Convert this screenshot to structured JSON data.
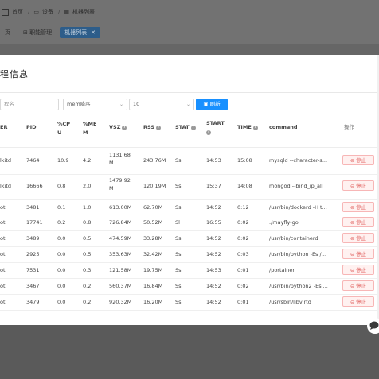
{
  "breadcrumb": {
    "items": [
      "首页",
      "设备",
      "机器列表"
    ]
  },
  "background_tabs": [
    {
      "label": "页"
    },
    {
      "label": "职能管理"
    },
    {
      "label": "机器列表"
    }
  ],
  "modal": {
    "title": "程信息",
    "filters": {
      "search_placeholder": "程名",
      "sort_select": "mem降序",
      "limit_select": "10",
      "refresh_label": "刷新"
    },
    "columns": [
      {
        "label": "ER"
      },
      {
        "label": "PID"
      },
      {
        "label": "%CP",
        "label2": "U"
      },
      {
        "label": "%ME",
        "label2": "M"
      },
      {
        "label": "VSZ",
        "help": true
      },
      {
        "label": "RSS",
        "help": true
      },
      {
        "label": "STAT",
        "help": true
      },
      {
        "label": "START",
        "help_below": true
      },
      {
        "label": "TIME",
        "help": true
      },
      {
        "label": "command"
      },
      {
        "label": "操作"
      }
    ],
    "stop_label": "停止",
    "rows": [
      {
        "user": "lkitd",
        "pid": "7464",
        "cpu": "10.9",
        "mem": "4.2",
        "vsz": "1131.68",
        "vsz2": "M",
        "rss": "243.76M",
        "stat": "Ssl",
        "start": "14:53",
        "time": "15:08",
        "command": "mysqld --character-s..."
      },
      {
        "user": "lkitd",
        "pid": "16666",
        "cpu": "0.8",
        "mem": "2.0",
        "vsz": "1479.92",
        "vsz2": "M",
        "rss": "120.19M",
        "stat": "Ssl",
        "start": "15:37",
        "time": "14:08",
        "command": "mongod --bind_ip_all"
      },
      {
        "user": "ot",
        "pid": "3481",
        "cpu": "0.1",
        "mem": "1.0",
        "vsz": "613.00M",
        "vsz2": "",
        "rss": "62.70M",
        "stat": "Ssl",
        "start": "14:52",
        "time": "0:12",
        "command": "/usr/bin/dockerd -H t..."
      },
      {
        "user": "ot",
        "pid": "17741",
        "cpu": "0.2",
        "mem": "0.8",
        "vsz": "726.84M",
        "vsz2": "",
        "rss": "50.52M",
        "stat": "Sl",
        "start": "16:55",
        "time": "0:02",
        "command": "./mayfly-go"
      },
      {
        "user": "ot",
        "pid": "3489",
        "cpu": "0.0",
        "mem": "0.5",
        "vsz": "474.59M",
        "vsz2": "",
        "rss": "33.28M",
        "stat": "Ssl",
        "start": "14:52",
        "time": "0:02",
        "command": "/usr/bin/containerd"
      },
      {
        "user": "ot",
        "pid": "2925",
        "cpu": "0.0",
        "mem": "0.5",
        "vsz": "353.63M",
        "vsz2": "",
        "rss": "32.42M",
        "stat": "Ssl",
        "start": "14:52",
        "time": "0:03",
        "command": "/usr/bin/python -Es /..."
      },
      {
        "user": "ot",
        "pid": "7531",
        "cpu": "0.0",
        "mem": "0.3",
        "vsz": "121.58M",
        "vsz2": "",
        "rss": "19.75M",
        "stat": "Ssl",
        "start": "14:53",
        "time": "0:01",
        "command": "/portainer"
      },
      {
        "user": "ot",
        "pid": "3467",
        "cpu": "0.0",
        "mem": "0.2",
        "vsz": "560.37M",
        "vsz2": "",
        "rss": "16.84M",
        "stat": "Ssl",
        "start": "14:52",
        "time": "0:02",
        "command": "/usr/bin/python2 -Es ..."
      },
      {
        "user": "ot",
        "pid": "3479",
        "cpu": "0.0",
        "mem": "0.2",
        "vsz": "920.32M",
        "vsz2": "",
        "rss": "16.20M",
        "stat": "Ssl",
        "start": "14:52",
        "time": "0:01",
        "command": "/usr/sbin/libvirtd"
      }
    ]
  },
  "colors": {
    "primary": "#1890ff",
    "danger": "#e0605e",
    "overlay": "#5a5a5a"
  }
}
